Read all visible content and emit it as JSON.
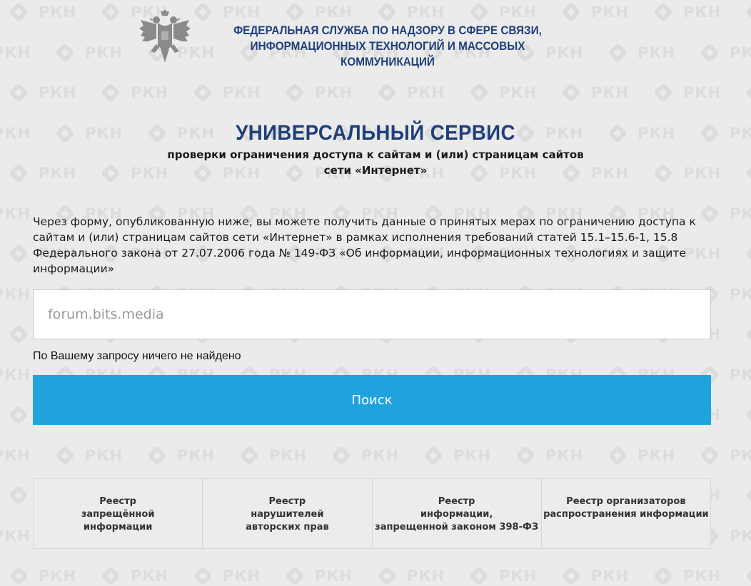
{
  "header": {
    "agency_line1": "ФЕДЕРАЛЬНАЯ СЛУЖБА ПО НАДЗОРУ В СФЕРЕ СВЯЗИ,",
    "agency_line2": "ИНФОРМАЦИОННЫХ ТЕХНОЛОГИЙ И МАССОВЫХ КОММУНИКАЦИЙ",
    "emblem_icon": "coat-of-arms-icon"
  },
  "watermark": {
    "text": "РКН"
  },
  "service": {
    "title": "УНИВЕРСАЛЬНЫЙ СЕРВИС",
    "subtitle_line1": "проверки ограничения доступа к сайтам и (или) страницам сайтов",
    "subtitle_line2": "сети «Интернет»"
  },
  "description": "Через форму, опубликованную ниже, вы можете получить данные о принятых мерах по ограничению доступа к сайтам и (или) страницам сайтов сети «Интернет» в рамках исполнения требований статей 15.1–15.6-1, 15.8 Федерального закона от 27.07.2006 года № 149-ФЗ «Об информации, информационных технологиях и защите информации»",
  "search": {
    "value": "forum.bits.media",
    "result_text": "По Вашему запросу ничего не найдено",
    "button_label": "Поиск"
  },
  "registers": [
    {
      "label": "Реестр\nзапрещённой\nинформации"
    },
    {
      "label": "Реестр\nнарушителей\nавторских прав"
    },
    {
      "label": "Реестр\nинформации,\nзапрещенной законом 398-ФЗ"
    },
    {
      "label": "Реестр организаторов\nраспространения информации"
    }
  ],
  "colors": {
    "background": "#ebebeb",
    "accent_blue": "#20a3dc",
    "heading_navy": "#1f3f7a",
    "watermark": "#dcdcdc"
  }
}
